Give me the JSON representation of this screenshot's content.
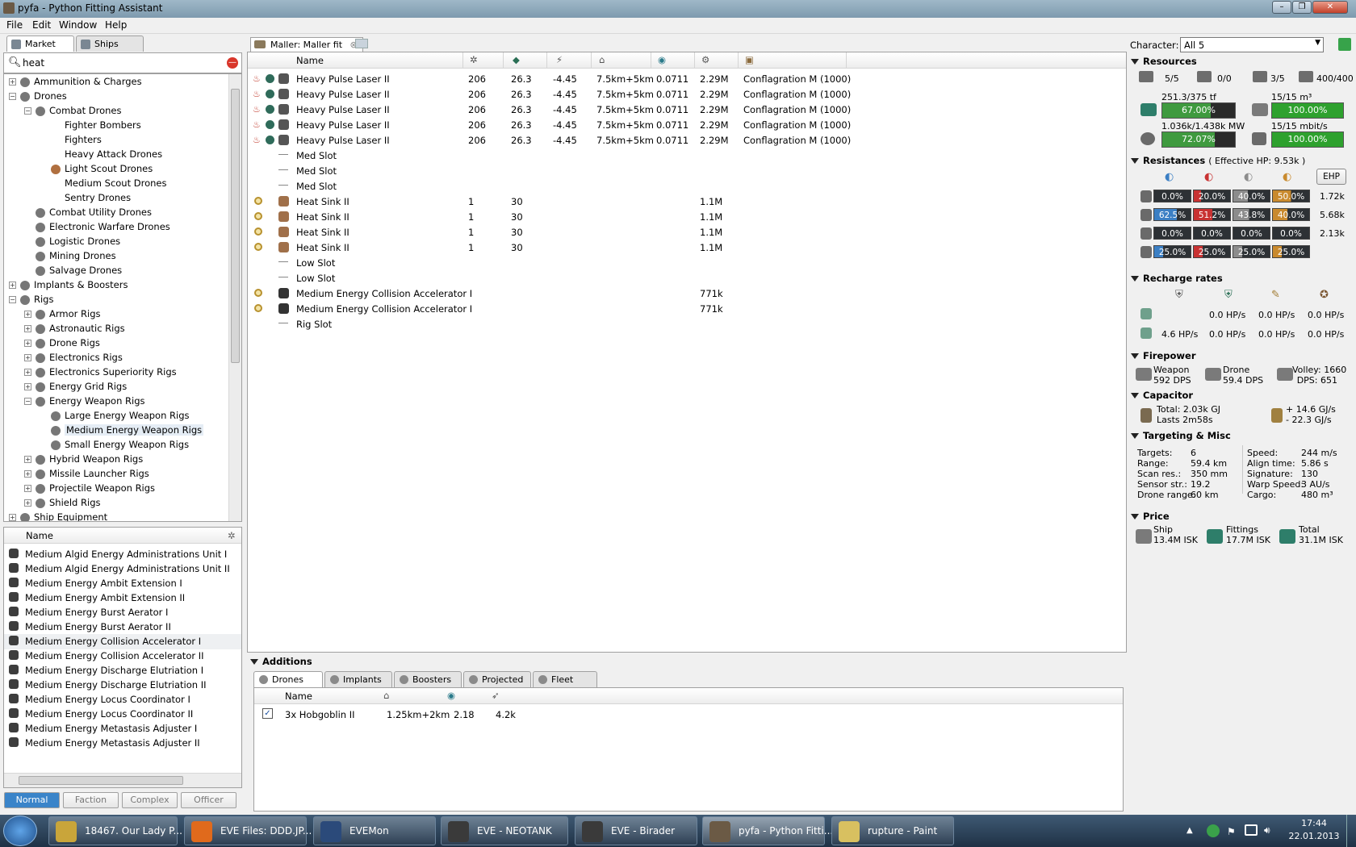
{
  "window": {
    "title": "pyfa - Python Fitting Assistant"
  },
  "menu": [
    "File",
    "Edit",
    "Window",
    "Help"
  ],
  "left_tabs": [
    "Market",
    "Ships"
  ],
  "search": {
    "value": "heat"
  },
  "market_tree": [
    {
      "label": "Ammunition & Charges",
      "indent": 0,
      "exp": "+"
    },
    {
      "label": "Drones",
      "indent": 0,
      "exp": "-"
    },
    {
      "label": "Combat Drones",
      "indent": 1,
      "exp": "-"
    },
    {
      "label": "Fighter Bombers",
      "indent": 2,
      "exp": ""
    },
    {
      "label": "Fighters",
      "indent": 2,
      "exp": ""
    },
    {
      "label": "Heavy Attack Drones",
      "indent": 2,
      "exp": ""
    },
    {
      "label": "Light Scout Drones",
      "indent": 2,
      "exp": ""
    },
    {
      "label": "Medium Scout Drones",
      "indent": 2,
      "exp": ""
    },
    {
      "label": "Sentry Drones",
      "indent": 2,
      "exp": ""
    },
    {
      "label": "Combat Utility Drones",
      "indent": 1,
      "exp": ""
    },
    {
      "label": "Electronic Warfare Drones",
      "indent": 1,
      "exp": ""
    },
    {
      "label": "Logistic Drones",
      "indent": 1,
      "exp": ""
    },
    {
      "label": "Mining Drones",
      "indent": 1,
      "exp": ""
    },
    {
      "label": "Salvage Drones",
      "indent": 1,
      "exp": ""
    },
    {
      "label": "Implants & Boosters",
      "indent": 0,
      "exp": "+"
    },
    {
      "label": "Rigs",
      "indent": 0,
      "exp": "-"
    },
    {
      "label": "Armor Rigs",
      "indent": 1,
      "exp": "+"
    },
    {
      "label": "Astronautic Rigs",
      "indent": 1,
      "exp": "+"
    },
    {
      "label": "Drone Rigs",
      "indent": 1,
      "exp": "+"
    },
    {
      "label": "Electronics Rigs",
      "indent": 1,
      "exp": "+"
    },
    {
      "label": "Electronics Superiority Rigs",
      "indent": 1,
      "exp": "+"
    },
    {
      "label": "Energy Grid Rigs",
      "indent": 1,
      "exp": "+"
    },
    {
      "label": "Energy Weapon Rigs",
      "indent": 1,
      "exp": "-"
    },
    {
      "label": "Large Energy Weapon Rigs",
      "indent": 2,
      "exp": ""
    },
    {
      "label": "Medium Energy Weapon Rigs",
      "indent": 2,
      "exp": "",
      "selected": true
    },
    {
      "label": "Small Energy Weapon Rigs",
      "indent": 2,
      "exp": ""
    },
    {
      "label": "Hybrid Weapon Rigs",
      "indent": 1,
      "exp": "+"
    },
    {
      "label": "Missile Launcher Rigs",
      "indent": 1,
      "exp": "+"
    },
    {
      "label": "Projectile Weapon Rigs",
      "indent": 1,
      "exp": "+"
    },
    {
      "label": "Shield Rigs",
      "indent": 1,
      "exp": "+"
    },
    {
      "label": "Ship Equipment",
      "indent": 0,
      "exp": "+"
    }
  ],
  "item_list": {
    "header": "Name",
    "items": [
      "Medium Algid Energy Administrations Unit I",
      "Medium Algid Energy Administrations Unit II",
      "Medium Energy Ambit Extension I",
      "Medium Energy Ambit Extension II",
      "Medium Energy Burst Aerator I",
      "Medium Energy Burst Aerator II",
      "Medium Energy Collision Accelerator I",
      "Medium Energy Collision Accelerator II",
      "Medium Energy Discharge Elutriation I",
      "Medium Energy Discharge Elutriation II",
      "Medium Energy Locus Coordinator I",
      "Medium Energy Locus Coordinator II",
      "Medium Energy Metastasis Adjuster I",
      "Medium Energy Metastasis Adjuster II"
    ]
  },
  "meta_buttons": [
    "Normal",
    "Faction",
    "Complex",
    "Officer"
  ],
  "fit_tab": "Maller: Maller fit",
  "fit_header": "Name",
  "modules": [
    {
      "name": "Heavy Pulse Laser II",
      "cpu": "206",
      "pg": "26.3",
      "cap": "-4.45",
      "range": "7.5km+5km",
      "track": "0.0711",
      "price": "2.29M",
      "charge": "Conflagration M (1000)",
      "type": "hi"
    },
    {
      "name": "Heavy Pulse Laser II",
      "cpu": "206",
      "pg": "26.3",
      "cap": "-4.45",
      "range": "7.5km+5km",
      "track": "0.0711",
      "price": "2.29M",
      "charge": "Conflagration M (1000)",
      "type": "hi"
    },
    {
      "name": "Heavy Pulse Laser II",
      "cpu": "206",
      "pg": "26.3",
      "cap": "-4.45",
      "range": "7.5km+5km",
      "track": "0.0711",
      "price": "2.29M",
      "charge": "Conflagration M (1000)",
      "type": "hi"
    },
    {
      "name": "Heavy Pulse Laser II",
      "cpu": "206",
      "pg": "26.3",
      "cap": "-4.45",
      "range": "7.5km+5km",
      "track": "0.0711",
      "price": "2.29M",
      "charge": "Conflagration M (1000)",
      "type": "hi"
    },
    {
      "name": "Heavy Pulse Laser II",
      "cpu": "206",
      "pg": "26.3",
      "cap": "-4.45",
      "range": "7.5km+5km",
      "track": "0.0711",
      "price": "2.29M",
      "charge": "Conflagration M (1000)",
      "type": "hi"
    },
    {
      "name": "Med Slot",
      "cpu": "",
      "pg": "",
      "cap": "",
      "range": "",
      "track": "",
      "price": "",
      "charge": "",
      "type": "empty"
    },
    {
      "name": "Med Slot",
      "cpu": "",
      "pg": "",
      "cap": "",
      "range": "",
      "track": "",
      "price": "",
      "charge": "",
      "type": "empty"
    },
    {
      "name": "Med Slot",
      "cpu": "",
      "pg": "",
      "cap": "",
      "range": "",
      "track": "",
      "price": "",
      "charge": "",
      "type": "empty"
    },
    {
      "name": "Heat Sink II",
      "cpu": "1",
      "pg": "30",
      "cap": "",
      "range": "",
      "track": "",
      "price": "1.1M",
      "charge": "",
      "type": "lo"
    },
    {
      "name": "Heat Sink II",
      "cpu": "1",
      "pg": "30",
      "cap": "",
      "range": "",
      "track": "",
      "price": "1.1M",
      "charge": "",
      "type": "lo"
    },
    {
      "name": "Heat Sink II",
      "cpu": "1",
      "pg": "30",
      "cap": "",
      "range": "",
      "track": "",
      "price": "1.1M",
      "charge": "",
      "type": "lo"
    },
    {
      "name": "Heat Sink II",
      "cpu": "1",
      "pg": "30",
      "cap": "",
      "range": "",
      "track": "",
      "price": "1.1M",
      "charge": "",
      "type": "lo"
    },
    {
      "name": "Low Slot",
      "cpu": "",
      "pg": "",
      "cap": "",
      "range": "",
      "track": "",
      "price": "",
      "charge": "",
      "type": "empty"
    },
    {
      "name": "Low Slot",
      "cpu": "",
      "pg": "",
      "cap": "",
      "range": "",
      "track": "",
      "price": "",
      "charge": "",
      "type": "empty"
    },
    {
      "name": "Medium Energy Collision Accelerator I",
      "cpu": "",
      "pg": "",
      "cap": "",
      "range": "",
      "track": "",
      "price": "771k",
      "charge": "",
      "type": "rig"
    },
    {
      "name": "Medium Energy Collision Accelerator I",
      "cpu": "",
      "pg": "",
      "cap": "",
      "range": "",
      "track": "",
      "price": "771k",
      "charge": "",
      "type": "rig"
    },
    {
      "name": "Rig Slot",
      "cpu": "",
      "pg": "",
      "cap": "",
      "range": "",
      "track": "",
      "price": "",
      "charge": "",
      "type": "empty"
    }
  ],
  "additions": {
    "title": "Additions",
    "tabs": [
      "Drones",
      "Implants",
      "Boosters",
      "Projected",
      "Fleet"
    ],
    "header": "Name",
    "drones": [
      {
        "name": "3x Hobgoblin II",
        "range": "1.25km+2km",
        "speed": "2.18",
        "dmg": "4.2k"
      }
    ]
  },
  "character": {
    "label": "Character:",
    "value": "All 5"
  },
  "resources": {
    "title": "Resources",
    "hi": "5/5",
    "turret": "0/0",
    "launcher": "3/5",
    "calib": "400/400",
    "cpu_text": "251.3/375 tf",
    "cpu_pct": "67.00%",
    "cpu_frac": 0.67,
    "drone_bay_text": "15/15 m³",
    "drone_bay_pct": "100.00%",
    "drone_bay_frac": 1.0,
    "pg_text": "1.036k/1.438k MW",
    "pg_pct": "72.07%",
    "pg_frac": 0.7207,
    "bandwidth_text": "15/15 mbit/s",
    "bandwidth_pct": "100.00%",
    "bandwidth_frac": 1.0
  },
  "resistances": {
    "title": "Resistances",
    "ehp_total": "( Effective HP: 9.53k )",
    "ehp_button": "EHP",
    "rows": [
      {
        "vals": [
          "0.0%",
          "20.0%",
          "40.0%",
          "50.0%"
        ],
        "hp": "1.72k"
      },
      {
        "vals": [
          "62.5%",
          "51.2%",
          "43.8%",
          "40.0%"
        ],
        "hp": "5.68k"
      },
      {
        "vals": [
          "0.0%",
          "0.0%",
          "0.0%",
          "0.0%"
        ],
        "hp": "2.13k"
      },
      {
        "vals": [
          "25.0%",
          "25.0%",
          "25.0%",
          "25.0%"
        ],
        "hp": ""
      }
    ]
  },
  "recharge": {
    "title": "Recharge rates",
    "row1": [
      "",
      "0.0 HP/s",
      "0.0 HP/s",
      "0.0 HP/s"
    ],
    "row2": [
      "4.6 HP/s",
      "0.0 HP/s",
      "0.0 HP/s",
      "0.0 HP/s"
    ]
  },
  "firepower": {
    "title": "Firepower",
    "weapon_label": "Weapon",
    "weapon_dps": "592 DPS",
    "drone_label": "Drone",
    "drone_dps": "59.4 DPS",
    "volley": "Volley: 1660",
    "dps": "DPS: 651"
  },
  "capacitor": {
    "title": "Capacitor",
    "total": "Total: 2.03k GJ",
    "lasts": "Lasts 2m58s",
    "plus": "+ 14.6 GJ/s",
    "minus": "- 22.3 GJ/s"
  },
  "targeting": {
    "title": "Targeting & Misc",
    "left": [
      [
        "Targets:",
        "6"
      ],
      [
        "Range:",
        "59.4 km"
      ],
      [
        "Scan res.:",
        "350 mm"
      ],
      [
        "Sensor str.:",
        "19.2"
      ],
      [
        "Drone range:",
        "60 km"
      ]
    ],
    "right": [
      [
        "Speed:",
        "244 m/s"
      ],
      [
        "Align time:",
        "5.86 s"
      ],
      [
        "Signature:",
        "130"
      ],
      [
        "Warp Speed:",
        "3 AU/s"
      ],
      [
        "Cargo:",
        "480 m³"
      ]
    ]
  },
  "price": {
    "title": "Price",
    "ship_label": "Ship",
    "ship": "13.4M ISK",
    "fittings_label": "Fittings",
    "fittings": "17.7M ISK",
    "total_label": "Total",
    "total": "31.1M ISK"
  },
  "taskbar": {
    "tasks": [
      "18467. Our Lady P...",
      "EVE Files: DDD.JP...",
      "EVEMon",
      "EVE - NEOTANK",
      "EVE - Birader",
      "pyfa - Python Fitti...",
      "rupture - Paint"
    ],
    "time": "17:44",
    "date": "22.01.2013"
  },
  "colors": {
    "accent": "#3a73b8",
    "green_bar": "#2e8b2e",
    "em": "#3b7fc4",
    "thermal": "#c83232",
    "kinetic": "#8c8c8c",
    "explosive": "#c98a2e"
  }
}
